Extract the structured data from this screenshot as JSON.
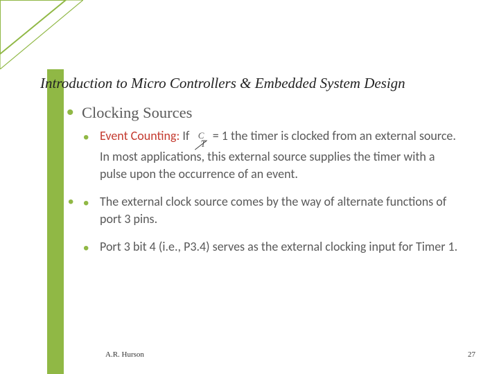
{
  "title": "Introduction to Micro Controllers & Embedded System Design",
  "heading": "Clocking Sources",
  "bullets": [
    {
      "lead": "Event Counting:",
      "text_before": " If ",
      "math_num": "C",
      "math_den": "T̅",
      "text_after": " = 1 the timer is clocked from an external source. In most applications, this external source supplies the timer with a pulse upon the occurrence of an event."
    },
    {
      "text": "The external clock source comes by the way of alternate functions of port 3 pins."
    },
    {
      "text": "Port 3 bit 4 (i.e., P3.4) serves as the external clocking input for Timer 1."
    }
  ],
  "footer": {
    "author": "A.R. Hurson",
    "page": "27"
  },
  "colors": {
    "accent": "#90b845",
    "emph": "#c43a2f"
  }
}
